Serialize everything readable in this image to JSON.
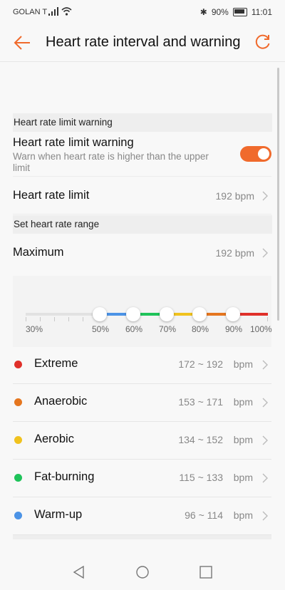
{
  "status_bar": {
    "carrier": "GOLAN T",
    "battery": "90%",
    "time": "11:01"
  },
  "app_bar": {
    "title": "Heart rate interval and warning"
  },
  "limit_section": {
    "header": "Heart rate limit warning",
    "toggle_title": "Heart rate limit warning",
    "toggle_desc": "Warn when heart rate is higher than the upper limit",
    "toggle_on": true,
    "limit_label": "Heart rate limit",
    "limit_value": "192 bpm"
  },
  "range_section": {
    "header": "Set heart rate range",
    "max_label": "Maximum",
    "max_value": "192 bpm",
    "percent_labels": [
      "30%",
      "50%",
      "60%",
      "70%",
      "80%",
      "90%",
      "100%"
    ]
  },
  "zones": [
    {
      "name": "Extreme",
      "range": "172 ~ 192",
      "unit": "bpm",
      "color": "#e0302a"
    },
    {
      "name": "Anaerobic",
      "range": "153 ~ 171",
      "unit": "bpm",
      "color": "#e5761f"
    },
    {
      "name": "Aerobic",
      "range": "134 ~ 152",
      "unit": "bpm",
      "color": "#f0c21e"
    },
    {
      "name": "Fat-burning",
      "range": "115 ~ 133",
      "unit": "bpm",
      "color": "#1fc35a"
    },
    {
      "name": "Warm-up",
      "range": "96 ~ 114",
      "unit": "bpm",
      "color": "#4c93e6"
    }
  ],
  "colors": {
    "accent": "#f06a2c"
  }
}
